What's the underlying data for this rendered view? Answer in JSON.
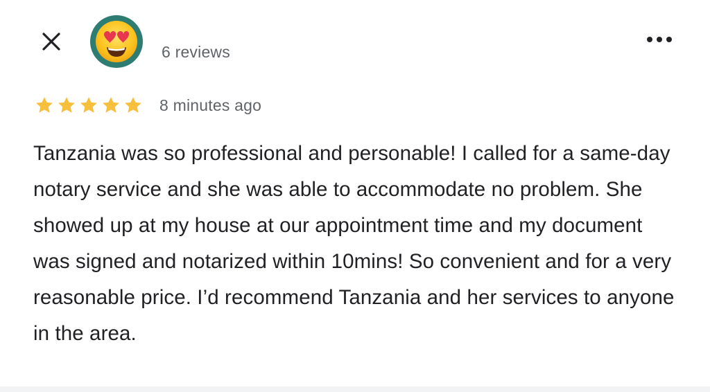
{
  "header": {
    "close_icon": "close-icon",
    "avatar_icon": "heart-eyes-emoji-icon",
    "avatar_bg": "#2e7d73",
    "review_count": "6 reviews",
    "more_icon": "more-horizontal-icon"
  },
  "review": {
    "rating": 5,
    "rating_max": 5,
    "star_color": "#f6bf3c",
    "timestamp": "8 minutes ago",
    "text": "Tanzania was so professional and personable! I called for a same-day notary service and she was able to accommodate no problem. She showed up at my house at our appointment time and my document was signed and notarized within 10mins! So convenient and for a very reasonable price. I’d recommend Tanzania and her services to anyone in the area."
  }
}
